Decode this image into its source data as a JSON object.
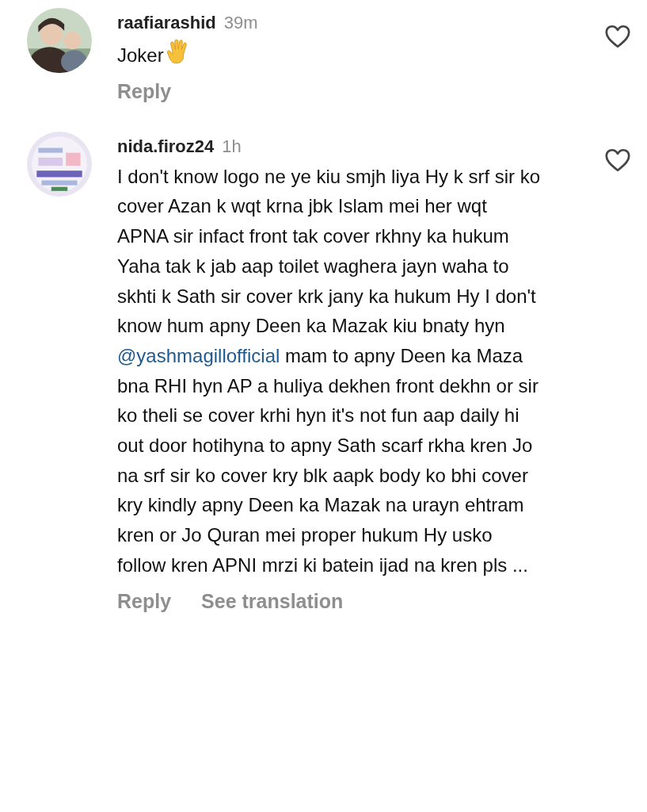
{
  "comments": [
    {
      "username": "raafiarashid",
      "time": "39m",
      "avatar": {
        "kind": "picture"
      },
      "liked": false,
      "segments": [
        {
          "kind": "text",
          "text": "Joker"
        },
        {
          "kind": "emoji"
        }
      ],
      "actions": [
        "Reply"
      ]
    },
    {
      "username": "nida.firoz24",
      "time": "1h",
      "avatar": {
        "kind": "picture"
      },
      "liked": false,
      "segments": [
        {
          "kind": "text",
          "text": "I don't know logo ne ye kiu smjh liya Hy k srf sir ko cover Azan k wqt krna jbk Islam mei her wqt APNA sir infact front tak cover rkhny ka hukum Yaha tak k jab aap toilet waghera jayn waha to skhti k Sath sir cover krk jany ka hukum Hy I don't know hum apny Deen ka Mazak kiu bnaty hyn "
        },
        {
          "kind": "mention",
          "text": "@yashmagillofficial"
        },
        {
          "kind": "text",
          "text": " mam to apny Deen ka Maza bna RHI hyn AP a huliya dekhen front dekhn or sir ko theli se cover krhi hyn it's not fun aap daily hi out door hotihyna to apny Sath scarf rkha kren Jo na srf sir ko cover kry blk aapk body ko bhi cover kry kindly apny Deen ka Mazak na urayn ehtram kren or Jo Quran mei proper hukum Hy usko follow kren APNI mrzi ki batein ijad na kren pls ..."
        }
      ],
      "actions": [
        "Reply",
        "See translation"
      ]
    }
  ]
}
